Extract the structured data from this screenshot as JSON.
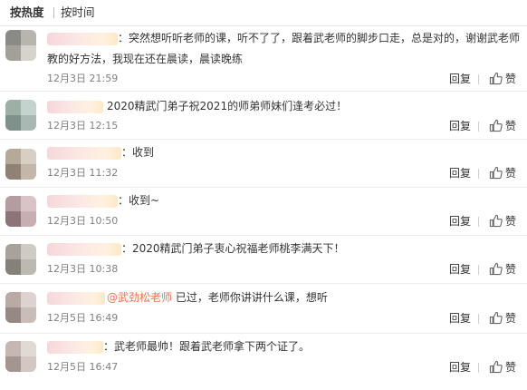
{
  "tabs": {
    "hot_label": "按热度",
    "time_label": "按时间"
  },
  "actions": {
    "reply_label": "回复",
    "like_label": "赞"
  },
  "comments": [
    {
      "text_line1": "：突然想听听老师的课，听不了了，跟着武老师的脚步口走，总是对的，谢谢武老师",
      "text_line2": "教的好方法，我现在还在晨读，晨读晚练",
      "time": "12月3日 21:59"
    },
    {
      "text": "2020精武门弟子祝2021的师弟师妹们逢考必过！",
      "time": "12月3日 12:15"
    },
    {
      "text": "：收到",
      "time": "12月3日 11:32"
    },
    {
      "text": "：收到~",
      "time": "12月3日 10:50"
    },
    {
      "text": "：2020精武门弟子衷心祝福老师桃李满天下！",
      "time": "12月3日 10:38"
    },
    {
      "mention": "@武劲松老师",
      "text": " 已过，老师你讲讲什么课，想听",
      "time": "12月5日 16:49"
    },
    {
      "text": "：武老师最帅！跟着武老师拿下两个证了。",
      "time": "12月5日 16:47"
    }
  ]
}
